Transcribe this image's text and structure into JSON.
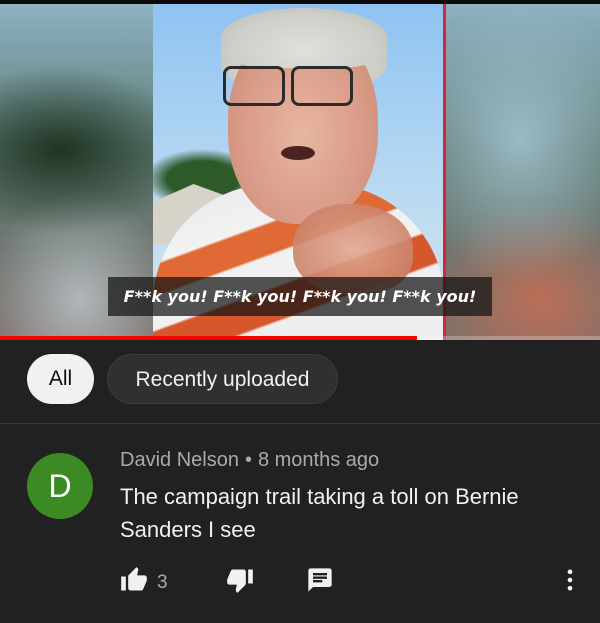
{
  "video": {
    "caption": "F**k you! F**k you! F**k you! F**k you!",
    "progress_fraction": 0.695
  },
  "chips": {
    "all": "All",
    "recently_uploaded": "Recently uploaded"
  },
  "comment": {
    "avatar_letter": "D",
    "avatar_color": "#3c8a23",
    "author": "David Nelson",
    "separator": "•",
    "time": "8 months ago",
    "text": "The campaign trail taking a toll on Bernie Sanders I see",
    "like_count": "3",
    "icons": [
      "thumbs-up-icon",
      "thumbs-down-icon",
      "reply-icon",
      "more-vertical-icon"
    ]
  },
  "colors": {
    "background": "#212121",
    "progress": "#ff0000",
    "chip_selected": "#f1f1f1",
    "chip_unselected": "#303030"
  }
}
